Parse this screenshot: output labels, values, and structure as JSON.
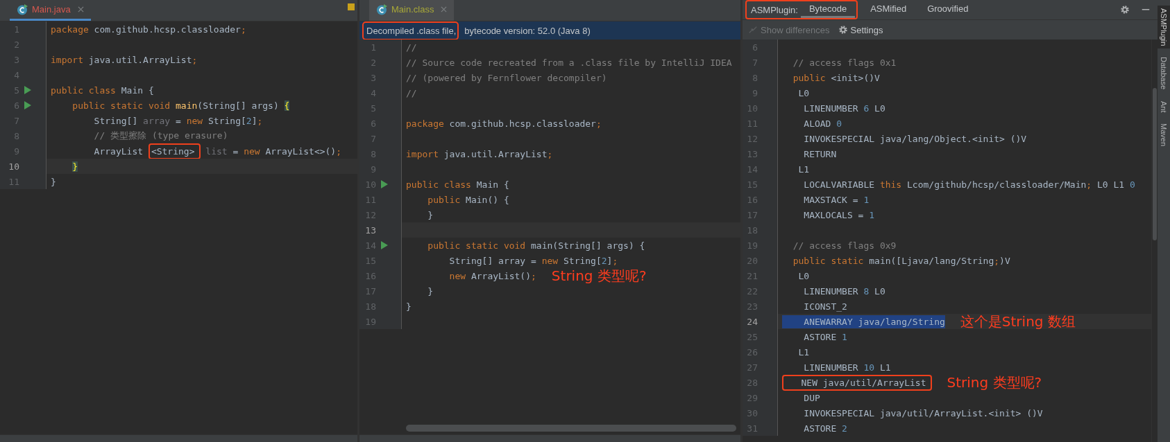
{
  "editors": [
    {
      "tab": {
        "label": "Main.java",
        "color": "#d6584f",
        "focused": true
      },
      "lines": [
        {
          "n": "1",
          "run": false,
          "current": false,
          "tokens": [
            {
              "kind": "kw",
              "t": "package"
            },
            {
              "kind": "tx",
              "t": " com.github.hcsp.classloader"
            },
            {
              "kind": "kw",
              "t": ";"
            }
          ]
        },
        {
          "n": "2",
          "run": false,
          "current": false
        },
        {
          "n": "3",
          "run": false,
          "current": false,
          "tokens": [
            {
              "kind": "kw",
              "t": "import"
            },
            {
              "kind": "tx",
              "t": " java.util.ArrayList"
            },
            {
              "kind": "kw",
              "t": ";"
            }
          ]
        },
        {
          "n": "4",
          "run": false,
          "current": false
        },
        {
          "n": "5",
          "run": true,
          "current": false,
          "tokens": [
            {
              "kind": "kw",
              "t": "public class "
            },
            {
              "kind": "tx",
              "t": "Main {"
            }
          ]
        },
        {
          "n": "6",
          "run": true,
          "current": false,
          "tokens": [
            {
              "kind": "kw",
              "t": "    public static void "
            },
            {
              "kind": "fn",
              "t": "main"
            },
            {
              "kind": "tx",
              "t": "(String[] args) "
            },
            {
              "kind": "brace",
              "t": "{"
            }
          ]
        },
        {
          "n": "7",
          "run": false,
          "current": false,
          "tokens": [
            {
              "kind": "tx",
              "t": "        String[] "
            },
            {
              "kind": "dim",
              "t": "array"
            },
            {
              "kind": "tx",
              "t": " = "
            },
            {
              "kind": "kw",
              "t": "new"
            },
            {
              "kind": "tx",
              "t": " String["
            },
            {
              "kind": "nm",
              "t": "2"
            },
            {
              "kind": "tx",
              "t": "]"
            },
            {
              "kind": "kw",
              "t": ";"
            }
          ]
        },
        {
          "n": "8",
          "run": false,
          "current": false,
          "tokens": [
            {
              "kind": "cm",
              "t": "        // 类型擦除 (type erasure)"
            }
          ]
        },
        {
          "n": "9",
          "run": false,
          "current": false,
          "tokens": [
            {
              "kind": "tx",
              "t": "        ArrayList "
            },
            {
              "kind": "boxed",
              "t": "<String>"
            },
            {
              "kind": "dim",
              "t": " list"
            },
            {
              "kind": "tx",
              "t": " = "
            },
            {
              "kind": "kw",
              "t": "new"
            },
            {
              "kind": "tx",
              "t": " ArrayList<>()"
            },
            {
              "kind": "kw",
              "t": ";"
            }
          ]
        },
        {
          "n": "10",
          "run": false,
          "current": true,
          "tokens": [
            {
              "kind": "brace",
              "t": "    }"
            }
          ]
        },
        {
          "n": "11",
          "run": false,
          "current": false,
          "tokens": [
            {
              "kind": "tx",
              "t": "}"
            }
          ]
        }
      ]
    },
    {
      "tab": {
        "label": "Main.class",
        "color": "#a8a838",
        "focused": false
      },
      "notice": [
        {
          "text": "Decompiled .class file,",
          "boxed": true
        },
        {
          "text": "bytecode version: 52.0 (Java 8)",
          "boxed": false
        }
      ],
      "lines": [
        {
          "n": "1",
          "run": false,
          "current": false,
          "tokens": [
            {
              "kind": "cm",
              "t": "//"
            }
          ]
        },
        {
          "n": "2",
          "run": false,
          "current": false,
          "tokens": [
            {
              "kind": "cm",
              "t": "// Source code recreated from a .class file by IntelliJ IDEA"
            }
          ]
        },
        {
          "n": "3",
          "run": false,
          "current": false,
          "tokens": [
            {
              "kind": "cm",
              "t": "// (powered by Fernflower decompiler)"
            }
          ]
        },
        {
          "n": "4",
          "run": false,
          "current": false,
          "tokens": [
            {
              "kind": "cm",
              "t": "//"
            }
          ]
        },
        {
          "n": "5",
          "run": false,
          "current": false
        },
        {
          "n": "6",
          "run": false,
          "current": false,
          "tokens": [
            {
              "kind": "kw",
              "t": "package"
            },
            {
              "kind": "tx",
              "t": " com.github.hcsp.classloader"
            },
            {
              "kind": "kw",
              "t": ";"
            }
          ]
        },
        {
          "n": "7",
          "run": false,
          "current": false
        },
        {
          "n": "8",
          "run": false,
          "current": false,
          "tokens": [
            {
              "kind": "kw",
              "t": "import"
            },
            {
              "kind": "tx",
              "t": " java.util.ArrayList"
            },
            {
              "kind": "kw",
              "t": ";"
            }
          ]
        },
        {
          "n": "9",
          "run": false,
          "current": false
        },
        {
          "n": "10",
          "run": true,
          "current": false,
          "tokens": [
            {
              "kind": "kw",
              "t": "public class "
            },
            {
              "kind": "tx",
              "t": "Main {"
            }
          ]
        },
        {
          "n": "11",
          "run": false,
          "current": false,
          "tokens": [
            {
              "kind": "kw",
              "t": "    public"
            },
            {
              "kind": "tx",
              "t": " Main() {"
            }
          ]
        },
        {
          "n": "12",
          "run": false,
          "current": false,
          "tokens": [
            {
              "kind": "tx",
              "t": "    }"
            }
          ]
        },
        {
          "n": "13",
          "run": false,
          "current": true
        },
        {
          "n": "14",
          "run": true,
          "current": false,
          "tokens": [
            {
              "kind": "kw",
              "t": "    public static void "
            },
            {
              "kind": "tx",
              "t": "main(String[] args) {"
            }
          ]
        },
        {
          "n": "15",
          "run": false,
          "current": false,
          "tokens": [
            {
              "kind": "tx",
              "t": "        String[] array = "
            },
            {
              "kind": "kw",
              "t": "new"
            },
            {
              "kind": "tx",
              "t": " String["
            },
            {
              "kind": "nm",
              "t": "2"
            },
            {
              "kind": "tx",
              "t": "]"
            },
            {
              "kind": "kw",
              "t": ";"
            }
          ]
        },
        {
          "n": "16",
          "run": false,
          "current": false,
          "tokens": [
            {
              "kind": "kw",
              "t": "        new"
            },
            {
              "kind": "tx",
              "t": " ArrayList()"
            },
            {
              "kind": "kw",
              "t": ";"
            }
          ],
          "note": "String 类型呢?"
        },
        {
          "n": "17",
          "run": false,
          "current": false,
          "tokens": [
            {
              "kind": "tx",
              "t": "    }"
            }
          ]
        },
        {
          "n": "18",
          "run": false,
          "current": false,
          "tokens": [
            {
              "kind": "tx",
              "t": "}"
            }
          ]
        },
        {
          "n": "19",
          "run": false,
          "current": false
        }
      ]
    }
  ],
  "tool_window": {
    "label": "ASMPlugin:",
    "annotated": true,
    "tabs": [
      {
        "label": "Bytecode",
        "selected": true
      },
      {
        "label": "ASMified",
        "selected": false
      },
      {
        "label": "Groovified",
        "selected": false
      }
    ],
    "toolbar": [
      {
        "kind": "diff",
        "label": "Show differences",
        "disabled": true
      },
      {
        "kind": "gear",
        "label": "Settings",
        "disabled": false
      }
    ],
    "lines": [
      {
        "n": "6",
        "current": false
      },
      {
        "n": "7",
        "current": false,
        "tokens": [
          {
            "kind": "cm",
            "t": "  // access flags 0x1"
          }
        ]
      },
      {
        "n": "8",
        "current": false,
        "tokens": [
          {
            "kind": "kw",
            "t": "  public"
          },
          {
            "kind": "tx",
            "t": " <init>()V"
          }
        ]
      },
      {
        "n": "9",
        "current": false,
        "tokens": [
          {
            "kind": "tx",
            "t": "   L0"
          }
        ]
      },
      {
        "n": "10",
        "current": false,
        "tokens": [
          {
            "kind": "tx",
            "t": "    LINENUMBER "
          },
          {
            "kind": "nm",
            "t": "6"
          },
          {
            "kind": "tx",
            "t": " L0"
          }
        ]
      },
      {
        "n": "11",
        "current": false,
        "tokens": [
          {
            "kind": "tx",
            "t": "    ALOAD "
          },
          {
            "kind": "nm",
            "t": "0"
          }
        ]
      },
      {
        "n": "12",
        "current": false,
        "tokens": [
          {
            "kind": "tx",
            "t": "    INVOKESPECIAL java/lang/Object.<init> ()V"
          }
        ]
      },
      {
        "n": "13",
        "current": false,
        "tokens": [
          {
            "kind": "tx",
            "t": "    RETURN"
          }
        ]
      },
      {
        "n": "14",
        "current": false,
        "tokens": [
          {
            "kind": "tx",
            "t": "   L1"
          }
        ]
      },
      {
        "n": "15",
        "current": false,
        "tokens": [
          {
            "kind": "tx",
            "t": "    LOCALVARIABLE "
          },
          {
            "kind": "kw",
            "t": "this"
          },
          {
            "kind": "tx",
            "t": " Lcom/github/hcsp/classloader/Main"
          },
          {
            "kind": "kw",
            "t": ";"
          },
          {
            "kind": "tx",
            "t": " L0 L1 "
          },
          {
            "kind": "nm",
            "t": "0"
          }
        ]
      },
      {
        "n": "16",
        "current": false,
        "tokens": [
          {
            "kind": "tx",
            "t": "    MAXSTACK = "
          },
          {
            "kind": "nm",
            "t": "1"
          }
        ]
      },
      {
        "n": "17",
        "current": false,
        "tokens": [
          {
            "kind": "tx",
            "t": "    MAXLOCALS = "
          },
          {
            "kind": "nm",
            "t": "1"
          }
        ]
      },
      {
        "n": "18",
        "current": false
      },
      {
        "n": "19",
        "current": false,
        "tokens": [
          {
            "kind": "cm",
            "t": "  // access flags 0x9"
          }
        ]
      },
      {
        "n": "20",
        "current": false,
        "tokens": [
          {
            "kind": "kw",
            "t": "  public static"
          },
          {
            "kind": "tx",
            "t": " main([Ljava/lang/String"
          },
          {
            "kind": "kw",
            "t": ";"
          },
          {
            "kind": "tx",
            "t": ")V"
          }
        ]
      },
      {
        "n": "21",
        "current": false,
        "tokens": [
          {
            "kind": "tx",
            "t": "   L0"
          }
        ]
      },
      {
        "n": "22",
        "current": false,
        "tokens": [
          {
            "kind": "tx",
            "t": "    LINENUMBER "
          },
          {
            "kind": "nm",
            "t": "8"
          },
          {
            "kind": "tx",
            "t": " L0"
          }
        ]
      },
      {
        "n": "23",
        "current": false,
        "tokens": [
          {
            "kind": "tx",
            "t": "    ICONST_2"
          }
        ]
      },
      {
        "n": "24",
        "current": true,
        "tokens": [
          {
            "kind": "sel",
            "t": "    ANEWARRAY java/lang/String"
          }
        ],
        "note": "这个是String 数组"
      },
      {
        "n": "25",
        "current": false,
        "tokens": [
          {
            "kind": "tx",
            "t": "    ASTORE "
          },
          {
            "kind": "nm",
            "t": "1"
          }
        ]
      },
      {
        "n": "26",
        "current": false,
        "tokens": [
          {
            "kind": "tx",
            "t": "   L1"
          }
        ]
      },
      {
        "n": "27",
        "current": false,
        "tokens": [
          {
            "kind": "tx",
            "t": "    LINENUMBER "
          },
          {
            "kind": "nm",
            "t": "10"
          },
          {
            "kind": "tx",
            "t": " L1"
          }
        ]
      },
      {
        "n": "28",
        "current": false,
        "tokens": [
          {
            "kind": "boxed",
            "t": "   NEW java/util/ArrayList"
          }
        ],
        "note": "String 类型呢?"
      },
      {
        "n": "29",
        "current": false,
        "tokens": [
          {
            "kind": "tx",
            "t": "    DUP"
          }
        ]
      },
      {
        "n": "30",
        "current": false,
        "tokens": [
          {
            "kind": "tx",
            "t": "    INVOKESPECIAL java/util/ArrayList.<init> ()V"
          }
        ]
      },
      {
        "n": "31",
        "current": false,
        "tokens": [
          {
            "kind": "tx",
            "t": "    ASTORE "
          },
          {
            "kind": "nm",
            "t": "2"
          }
        ]
      }
    ]
  },
  "side_strip": [
    {
      "label": "ASMPlugin",
      "selected": true
    },
    {
      "label": "Database",
      "selected": false
    },
    {
      "label": "Ant",
      "selected": false
    },
    {
      "label": "Maven",
      "selected": false
    }
  ]
}
